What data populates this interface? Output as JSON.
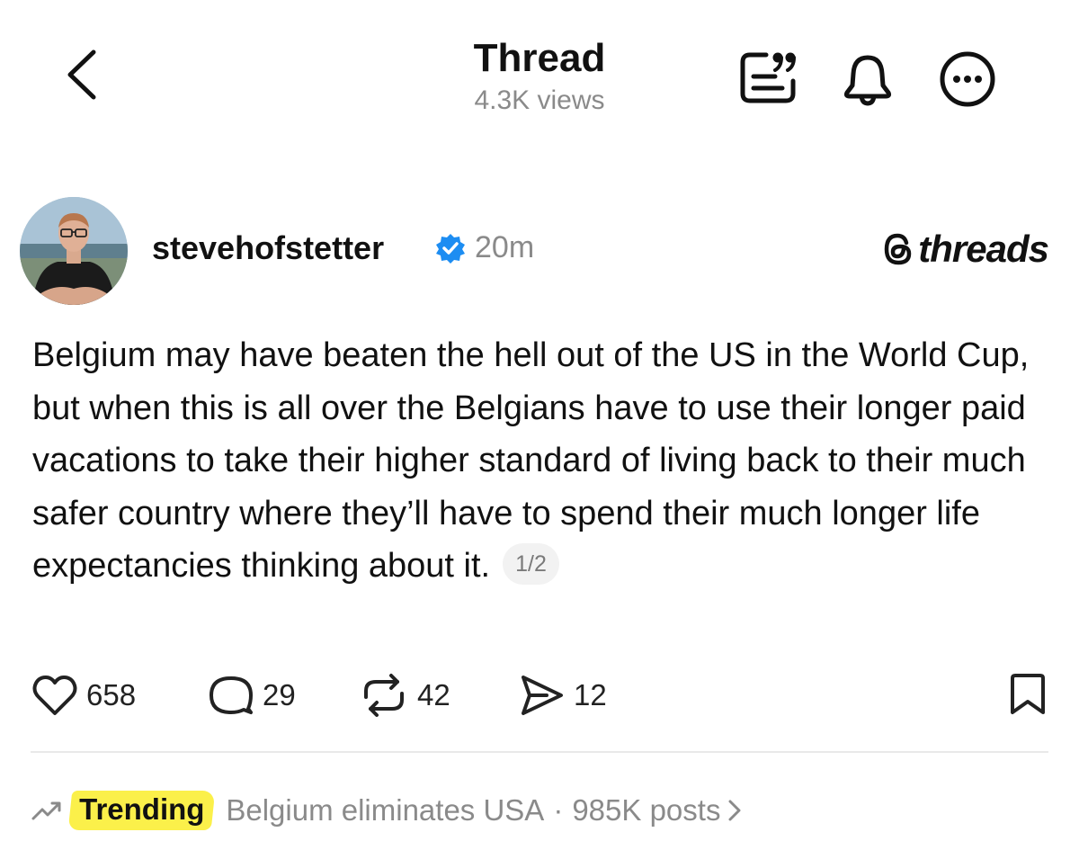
{
  "header": {
    "title": "Thread",
    "views": "4.3K views",
    "icons": [
      "chevron-left-icon",
      "quotes-icon",
      "bell-icon",
      "more-icon"
    ]
  },
  "post": {
    "username": "stevehofstetter",
    "verified": true,
    "time": "20m",
    "brand": "threads",
    "text": "Belgium may have beaten the hell out of the US in the World Cup, but when this is all over the Belgians have to use their longer paid vacations to take their higher standard of living back to their much safer country where they’ll have to spend their much longer life expectancies thinking about it.",
    "page_indicator": "1/2",
    "actions": {
      "likes": "658",
      "replies": "29",
      "reposts": "42",
      "shares": "12"
    }
  },
  "trending": {
    "label": "Trending",
    "topic": "Belgium eliminates USA",
    "separator": "·",
    "posts": "985K posts"
  },
  "colors": {
    "text": "#111111",
    "secondary": "#8a8a8a",
    "verified_blue": "#1d8df2",
    "highlight": "#fbf04a",
    "divider": "#e9e9e9"
  }
}
